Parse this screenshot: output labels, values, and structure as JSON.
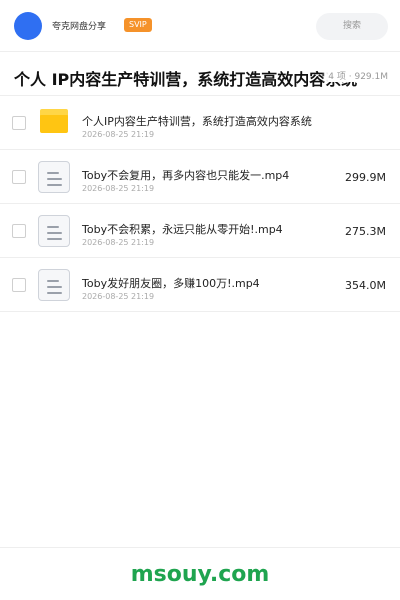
{
  "header": {
    "app_name": "夸克网盘分享",
    "badge": "SVIP",
    "search_placeholder": "搜索",
    "avatar_color": "#2f6ff2",
    "badge_color": "#f5922a"
  },
  "share": {
    "title": "个人 IP内容生产特训营，系统打造高效内容系统",
    "meta": "4 项 · 929.1M"
  },
  "files": [
    {
      "type": "folder",
      "icon": "folder-icon",
      "name": "个人IP内容生产特训营，系统打造高效内容系统",
      "date": "2026-08-25 21:19",
      "size": ""
    },
    {
      "type": "file",
      "icon": "video-file-icon",
      "name": "Toby不会复用，再多内容也只能发一.mp4",
      "date": "2026-08-25 21:19",
      "size": "299.9M"
    },
    {
      "type": "file",
      "icon": "video-file-icon",
      "name": "Toby不会积累，永远只能从零开始!.mp4",
      "date": "2026-08-25 21:19",
      "size": "275.3M"
    },
    {
      "type": "file",
      "icon": "video-file-icon",
      "name": "Toby发好朋友圈，多赚100万!.mp4",
      "date": "2026-08-25 21:19",
      "size": "354.0M"
    }
  ],
  "footer": {
    "watermark": "msouy.com",
    "watermark_color": "#1fa44f"
  }
}
